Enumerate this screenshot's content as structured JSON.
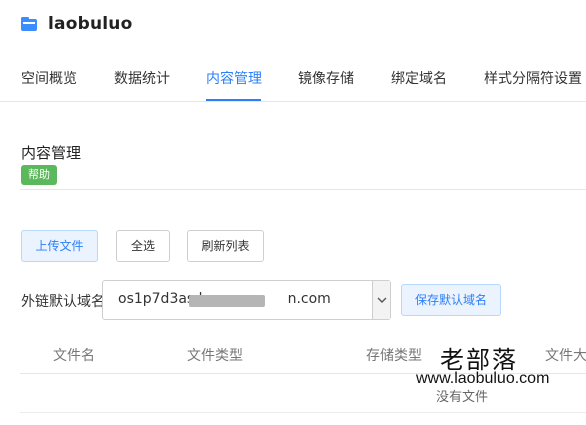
{
  "bucket": {
    "name": "laobuluo",
    "icon": "bucket-icon"
  },
  "tabs": [
    {
      "label": "空间概览"
    },
    {
      "label": "数据统计"
    },
    {
      "label": "内容管理"
    },
    {
      "label": "镜像存储"
    },
    {
      "label": "绑定域名"
    },
    {
      "label": "样式分隔符设置"
    }
  ],
  "active_tab": "内容管理",
  "section": {
    "title": "内容管理",
    "help_label": "帮助"
  },
  "toolbar": {
    "upload_label": "上传文件",
    "select_all_label": "全选",
    "refresh_label": "刷新列表"
  },
  "domain": {
    "label": "外链默认域名",
    "value_prefix": "os1p7d3as.b",
    "value_suffix": "n.com",
    "save_label": "保存默认域名"
  },
  "table": {
    "columns": [
      "文件名",
      "文件类型",
      "存储类型",
      "文件大"
    ],
    "empty_text": "没有文件"
  },
  "watermark": {
    "name": "老部落",
    "url": "www.laobuluo.com"
  },
  "colors": {
    "accent": "#2d7ff9",
    "help_badge": "#5cb85c"
  }
}
